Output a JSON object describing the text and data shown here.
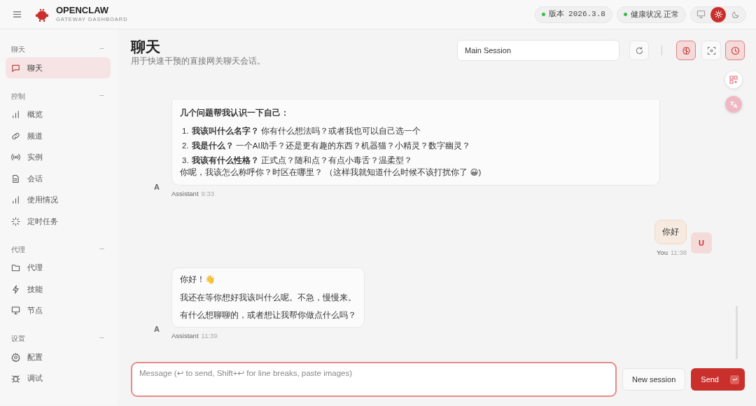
{
  "header": {
    "brand": "OPENCLAW",
    "tagline": "GATEWAY DASHBOARD",
    "pills": [
      {
        "label": "版本",
        "value": "2026.3.8",
        "color": "#3fb950"
      },
      {
        "label": "健康状况",
        "value": "正常",
        "color": "#3fb950"
      }
    ],
    "theme_modes": [
      {
        "kind": "monitor",
        "selected": false
      },
      {
        "kind": "sun",
        "selected": true
      },
      {
        "kind": "moon",
        "selected": false
      }
    ]
  },
  "sidebar": {
    "groups": [
      {
        "label": "聊天",
        "items": [
          {
            "label": "聊天",
            "selected": true
          }
        ]
      },
      {
        "label": "控制",
        "items": [
          {
            "label": "概览",
            "selected": false
          },
          {
            "label": "频道",
            "selected": false
          },
          {
            "label": "实例",
            "selected": false
          },
          {
            "label": "会话",
            "selected": false
          },
          {
            "label": "使用情况",
            "selected": false
          },
          {
            "label": "定时任务",
            "selected": false
          }
        ]
      },
      {
        "label": "代理",
        "items": [
          {
            "label": "代理",
            "selected": false
          },
          {
            "label": "技能",
            "selected": false
          },
          {
            "label": "节点",
            "selected": false
          }
        ]
      },
      {
        "label": "设置",
        "items": [
          {
            "label": "配置",
            "selected": false
          },
          {
            "label": "调试",
            "selected": false
          }
        ]
      }
    ]
  },
  "page": {
    "title": "聊天",
    "subtitle": "用于快速干预的直接网关聊天会话。",
    "session": "Main Session",
    "tools": [
      {
        "kind": "refresh",
        "on": false
      },
      {
        "kind": "brain",
        "on": true
      },
      {
        "kind": "focus",
        "on": false
      },
      {
        "kind": "clock",
        "on": true
      }
    ]
  },
  "messages": [
    {
      "kind": "assistant",
      "avatar": "A",
      "author": "Assistant",
      "time": "9:33",
      "blocks": [
        {
          "kind": "heading",
          "text": "几个问题帮我认识一下自己："
        },
        {
          "kind": "list",
          "items": [
            {
              "marker": "1.",
              "text": "**我该叫什么名字？** 你有什么想法吗？或者我也可以自己选一个"
            },
            {
              "marker": "2.",
              "text": "**我是什么？** 一个AI助手？还是更有趣的东西？机器猫？小精灵？数字幽灵？"
            },
            {
              "marker": "3.",
              "text": "**我该有什么性格？** 正式点？随和点？有点小毒舌？温柔型？"
            }
          ]
        },
        {
          "kind": "tight",
          "text": "你呢，我该怎么称呼你？时区在哪里？ （这样我就知道什么时候不该打扰你了 😀)"
        }
      ]
    },
    {
      "kind": "user",
      "avatar": "U",
      "author": "You",
      "time": "11:38",
      "blocks": [
        {
          "kind": "text",
          "text": "你好"
        }
      ]
    },
    {
      "kind": "assistant",
      "avatar": "A",
      "author": "Assistant",
      "time": "11:39",
      "blocks": [
        {
          "kind": "text",
          "text": "你好！👋"
        },
        {
          "kind": "text",
          "text": "我还在等你想好我该叫什么呢。不急，慢慢来。"
        },
        {
          "kind": "text",
          "text": "有什么想聊聊的，或者想让我帮你做点什么吗？"
        }
      ]
    }
  ],
  "composer": {
    "placeholder": "Message (↩ to send, Shift+↩ for line breaks, paste images)",
    "secondary": "New session",
    "primary": "Send"
  }
}
